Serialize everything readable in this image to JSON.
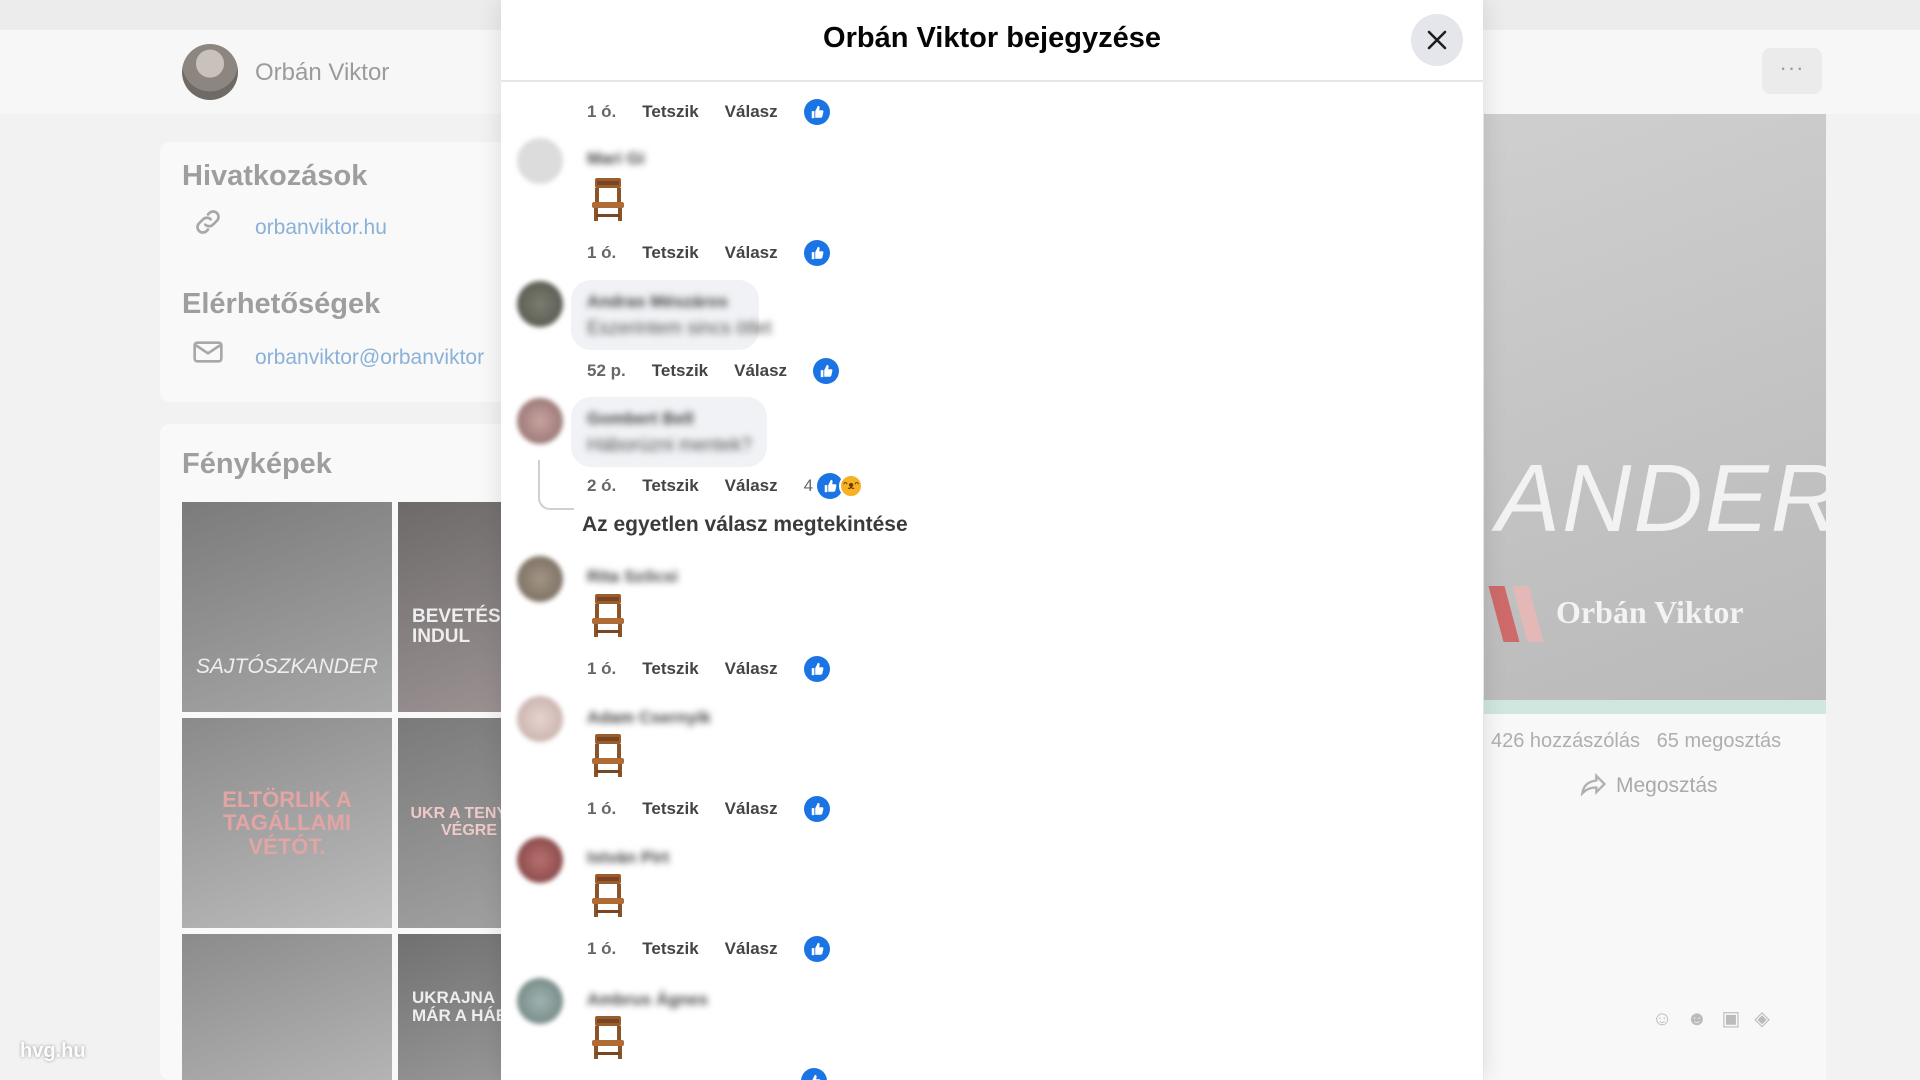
{
  "background": {
    "profile_name": "Orbán Viktor",
    "more_label": "···",
    "links_section": {
      "title": "Hivatkozások",
      "website": "orbanviktor.hu",
      "contact_title": "Elérhetőségek",
      "email": "orbanviktor@orbanviktor"
    },
    "photos_section": {
      "title": "Fényképek",
      "photos": [
        {
          "caption": "SAJTÓSZKANDER"
        },
        {
          "caption": "BEVETÉS INDUL"
        },
        {
          "caption": "ELTÖRLIK A TAGÁLLAMI VÉTÓT."
        },
        {
          "caption": "UKR A TENYLE VÉGRE"
        },
        {
          "caption": ""
        },
        {
          "caption": "UKRAJNA MÁR A HÁBO"
        }
      ]
    },
    "post_image": {
      "overlay_text": "ANDER",
      "brand_text": "Orbán Viktor"
    },
    "post_stats": {
      "comments": "426 hozzászólás",
      "shares": "65 megosztás",
      "share_button": "Megosztás"
    },
    "composer_icons": [
      "sticker-icon",
      "emoji-icon",
      "gif-icon",
      "sticker-alt-icon"
    ],
    "watermark": "hvg.hu"
  },
  "modal": {
    "title": "Orbán Viktor bejegyzése",
    "close_icon": "close-icon",
    "like_label": "Tetszik",
    "reply_label": "Válasz",
    "accent_color": "#1b74e4",
    "comments": [
      {
        "author": "",
        "text": "",
        "time": "1 ó.",
        "reactions": [
          "like"
        ]
      },
      {
        "author": "Mari Gi",
        "emoji": "chair-icon",
        "time": "1 ó.",
        "reactions": [
          "like"
        ]
      },
      {
        "author": "Andras Mészáros",
        "text": "Eszerintem sincs ötlet",
        "time": "52 p.",
        "reactions": [
          "like"
        ]
      },
      {
        "author": "Gombert Bell",
        "text": "Háborúzni mentek?",
        "time": "2 ó.",
        "reaction_count": "4",
        "reactions": [
          "like",
          "haha"
        ],
        "view_replies": "Az egyetlen válasz megtekintése"
      },
      {
        "author": "Rita Szőcsi",
        "emoji": "chair-icon",
        "time": "1 ó.",
        "reactions": [
          "like"
        ]
      },
      {
        "author": "Adam Csernyik",
        "emoji": "chair-icon",
        "time": "1 ó.",
        "reactions": [
          "like"
        ]
      },
      {
        "author": "István Pirt",
        "emoji": "chair-icon",
        "time": "1 ó.",
        "reactions": [
          "like"
        ]
      },
      {
        "author": "Ambrus Ágnes",
        "emoji": "chair-icon",
        "time": "",
        "reactions": [
          "like"
        ]
      }
    ]
  }
}
